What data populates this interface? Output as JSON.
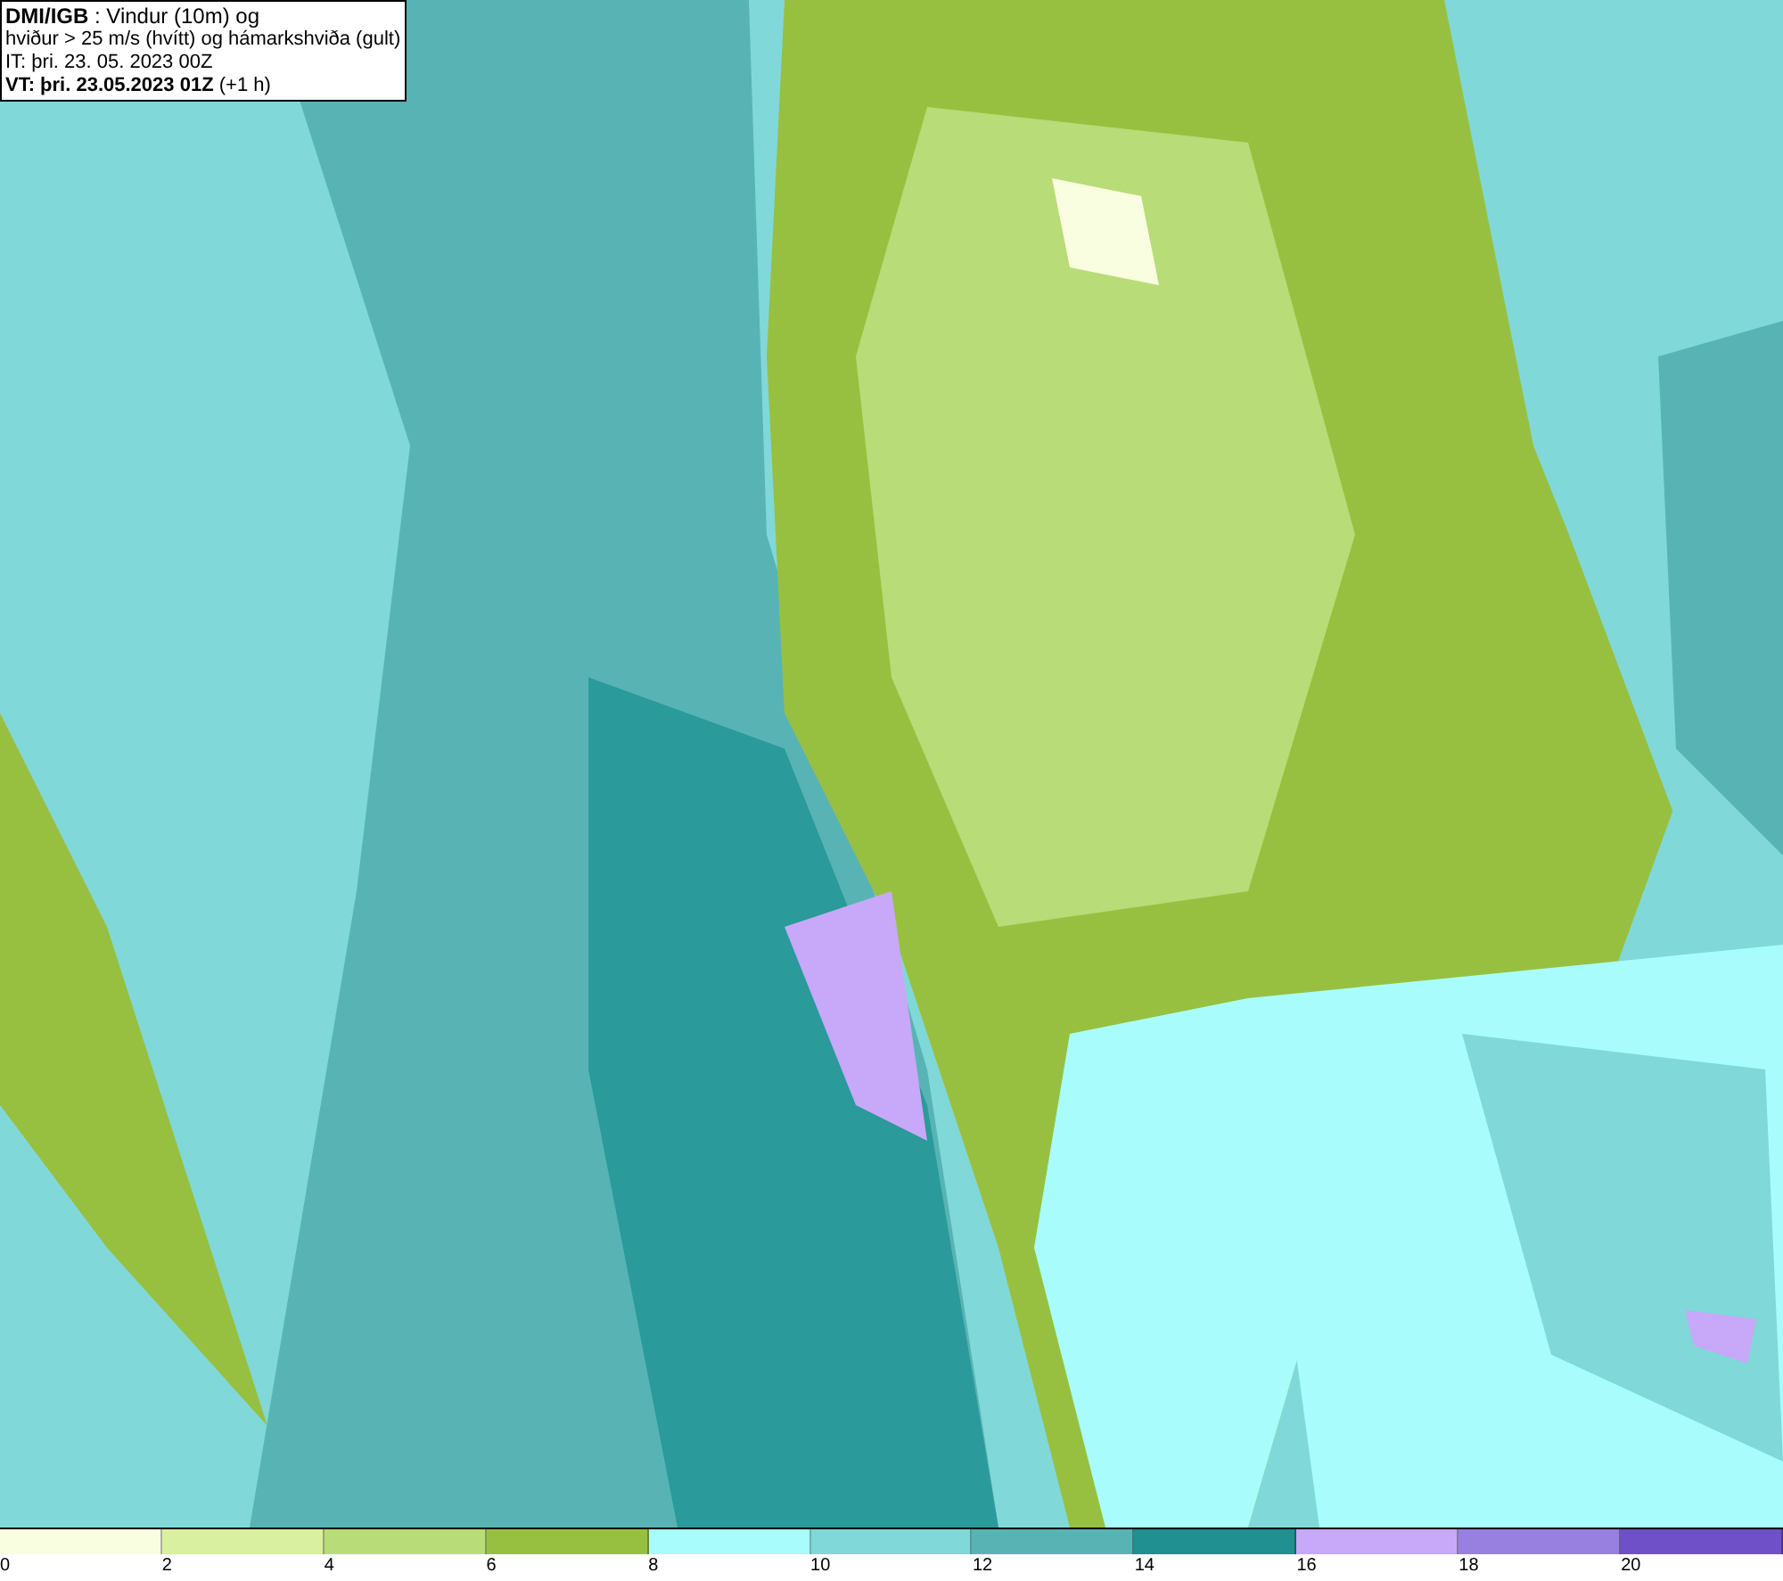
{
  "header": {
    "lines": [
      "**DMI/IGB** : Vindur (10m) og",
      "hviður > 25 m/s (hvítt) og hámarkshviða (gult)",
      "IT: þri. 23. 05. 2023 00Z",
      "**VT: þri. 23.05.2023 01Z** (+1 h)"
    ]
  },
  "legend": {
    "segments": [
      {
        "label": "0",
        "color": "#fafee0"
      },
      {
        "label": "2",
        "color": "#d8f0a0"
      },
      {
        "label": "4",
        "color": "#b8dc78"
      },
      {
        "label": "6",
        "color": "#98c040"
      },
      {
        "label": "8",
        "color": "#a8fcfc"
      },
      {
        "label": "10",
        "color": "#80d8d8"
      },
      {
        "label": "12",
        "color": "#58b4b4"
      },
      {
        "label": "14",
        "color": "#209090"
      },
      {
        "label": "16",
        "color": "#c8a8f8"
      },
      {
        "label": "18",
        "color": "#9880e0"
      },
      {
        "label": "20",
        "color": "#7050c8"
      }
    ]
  }
}
